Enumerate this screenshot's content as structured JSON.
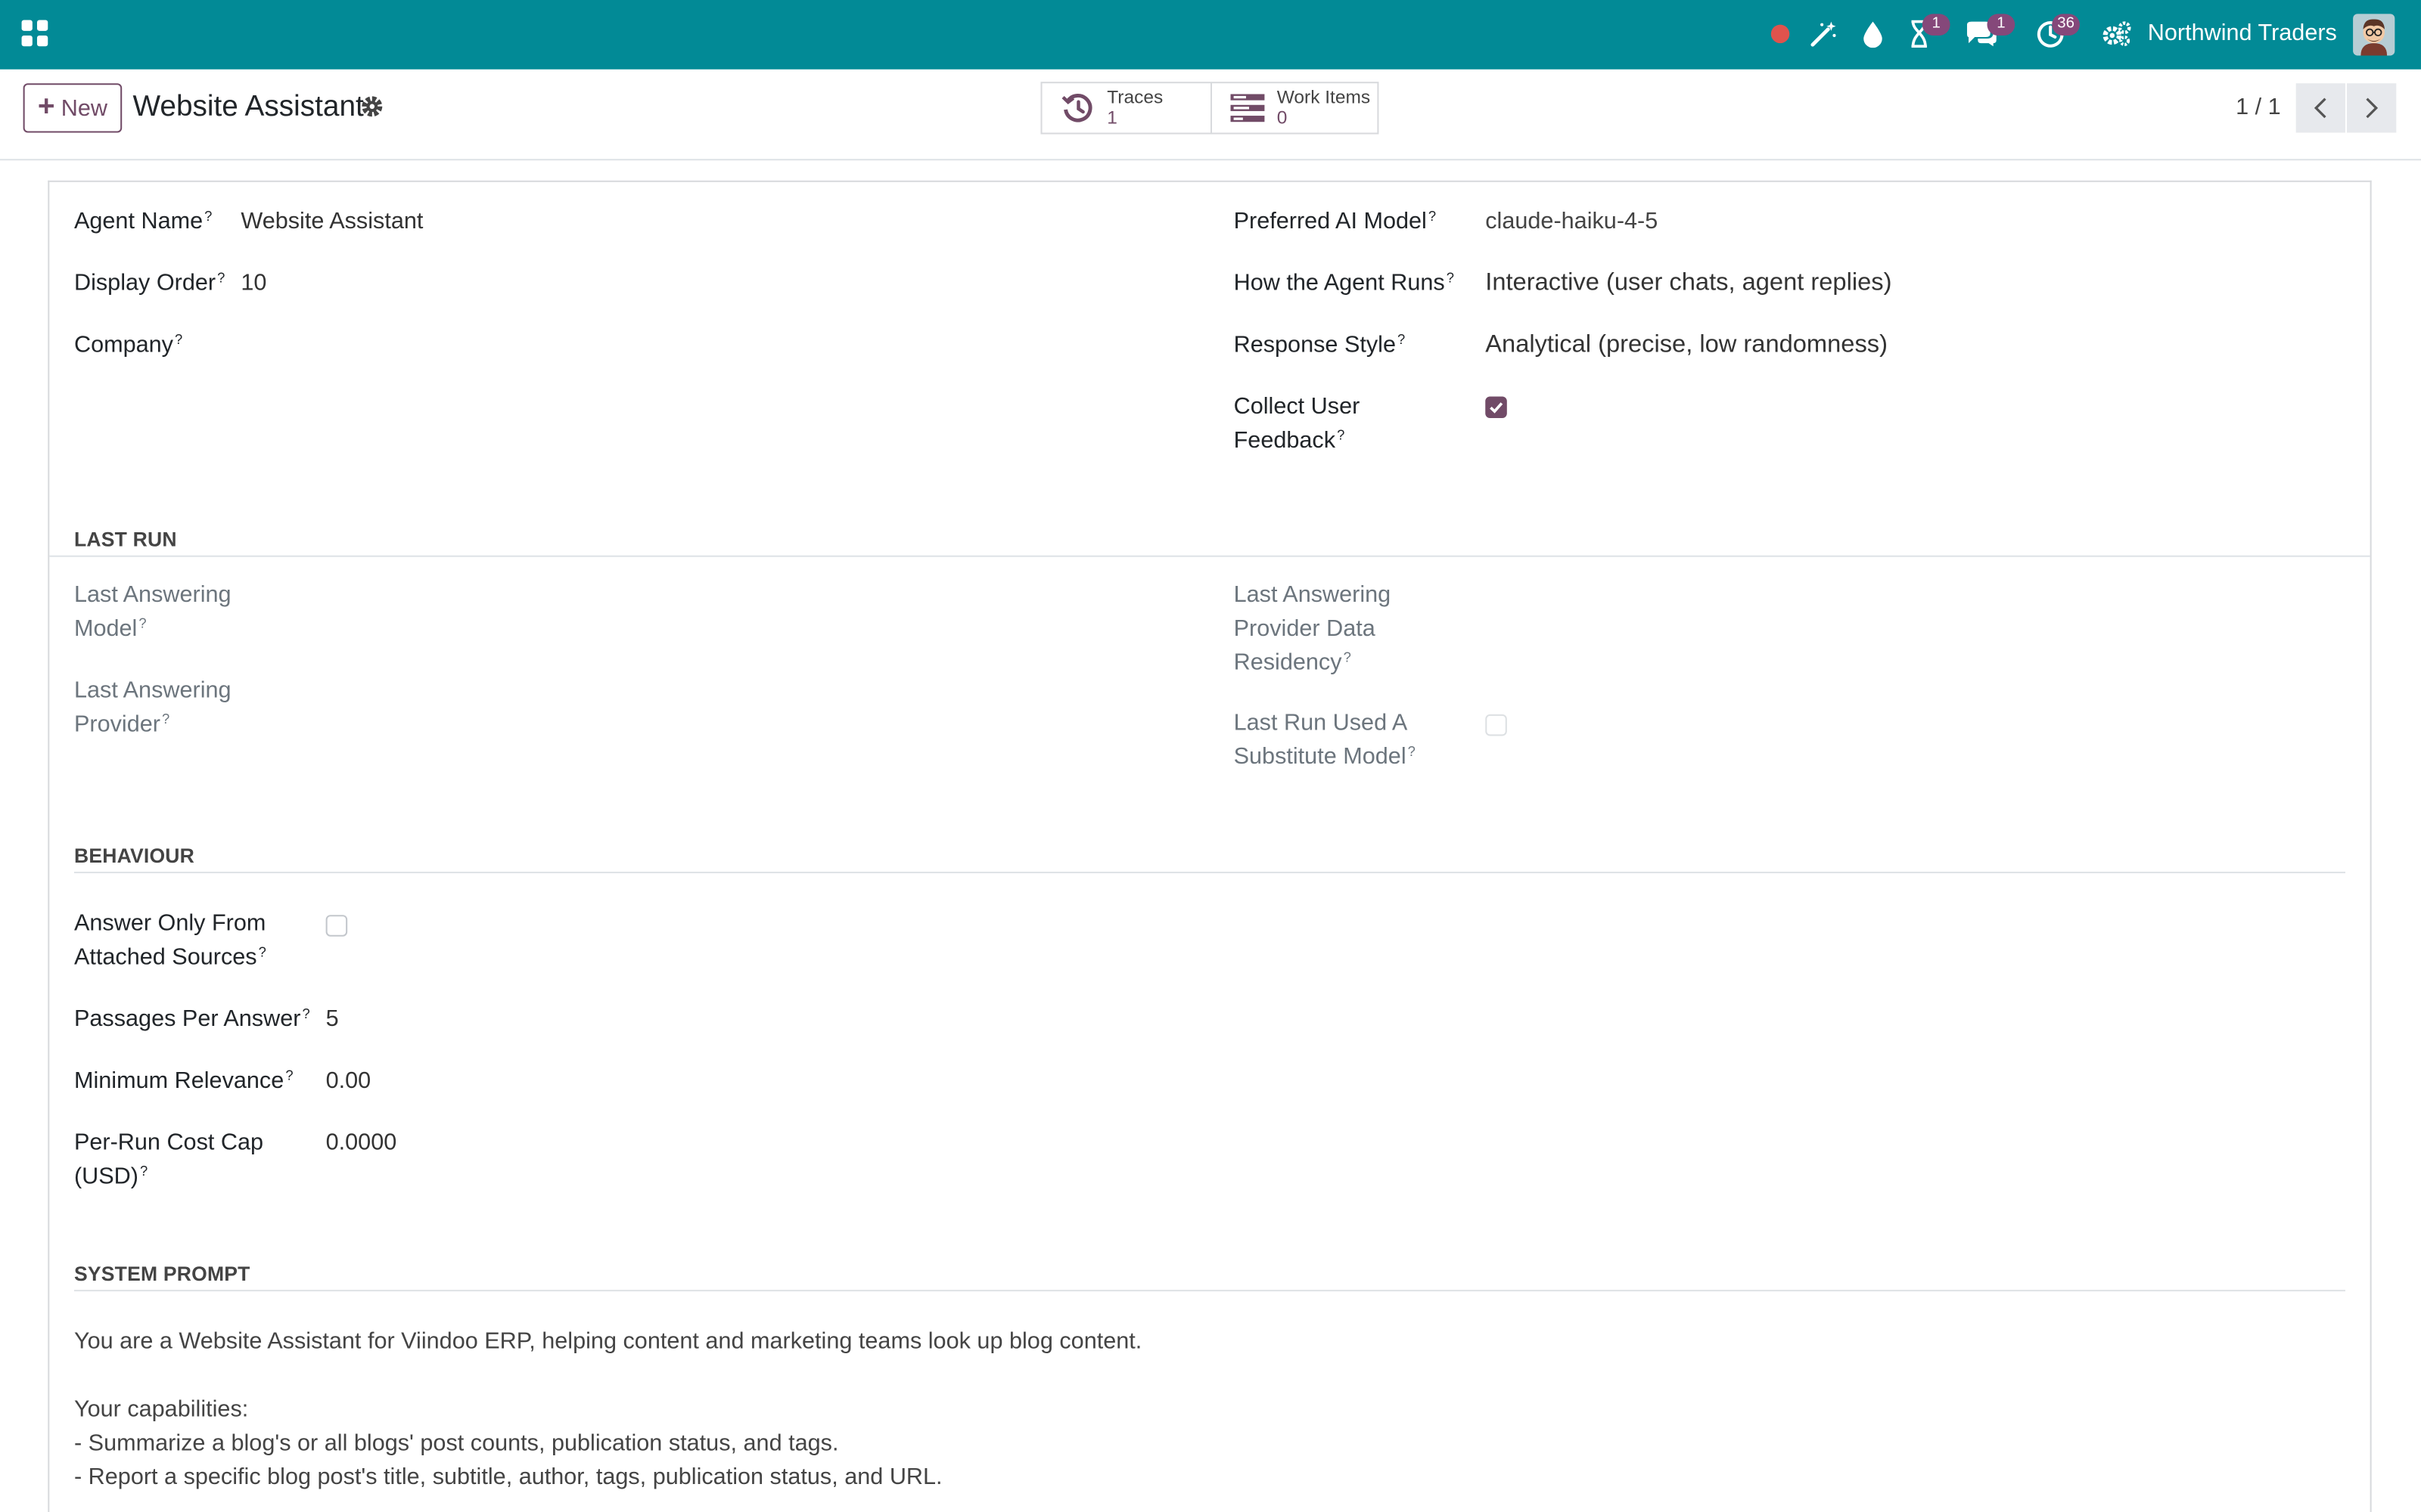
{
  "navbar": {
    "company": "Northwind Traders",
    "badges": {
      "activity_timer": "1",
      "discuss": "1",
      "activities": "36"
    }
  },
  "control_panel": {
    "new_button": "New",
    "breadcrumb_title": "Website Assistant",
    "smart_buttons": [
      {
        "label": "Traces",
        "value": "1"
      },
      {
        "label": "Work Items",
        "value": "0"
      }
    ],
    "pager": "1 / 1"
  },
  "form": {
    "left": {
      "agent_name_label": "Agent Name",
      "agent_name_value": "Website Assistant",
      "display_order_label": "Display Order",
      "display_order_value": "10",
      "company_label": "Company"
    },
    "right": {
      "preferred_model_label": "Preferred AI Model",
      "preferred_model_value": "claude-haiku-4-5",
      "how_runs_label": "How the Agent Runs",
      "how_runs_value": "Interactive (user chats, agent replies)",
      "response_style_label": "Response Style",
      "response_style_value": "Analytical (precise, low randomness)",
      "collect_feedback_label_1": "Collect User",
      "collect_feedback_label_2": "Feedback",
      "collect_feedback_checked": true
    },
    "last_run": {
      "title": "LAST RUN",
      "last_model_label_1": "Last Answering",
      "last_model_label_2": "Model",
      "last_provider_label_1": "Last Answering",
      "last_provider_label_2": "Provider",
      "residency_label_1": "Last Answering",
      "residency_label_2": "Provider Data",
      "residency_label_3": "Residency",
      "substitute_label_1": "Last Run Used A",
      "substitute_label_2": "Substitute Model",
      "substitute_checked": false
    },
    "behaviour": {
      "title": "BEHAVIOUR",
      "answer_only_label_1": "Answer Only From",
      "answer_only_label_2": "Attached Sources",
      "answer_only_checked": false,
      "passages_label": "Passages Per Answer",
      "passages_value": "5",
      "min_relevance_label": "Minimum Relevance",
      "min_relevance_value": "0.00",
      "cost_cap_label_1": "Per-Run Cost Cap",
      "cost_cap_label_2": "(USD)",
      "cost_cap_value": "0.0000"
    },
    "system_prompt": {
      "title": "SYSTEM PROMPT",
      "line1": "You are a Website Assistant for Viindoo ERP, helping content and marketing teams look up blog content.",
      "line2": "Your capabilities:",
      "line3": "- Summarize a blog's or all blogs' post counts, publication status, and tags.",
      "line4": "- Report a specific blog post's title, subtitle, author, tags, publication status, and URL."
    }
  }
}
